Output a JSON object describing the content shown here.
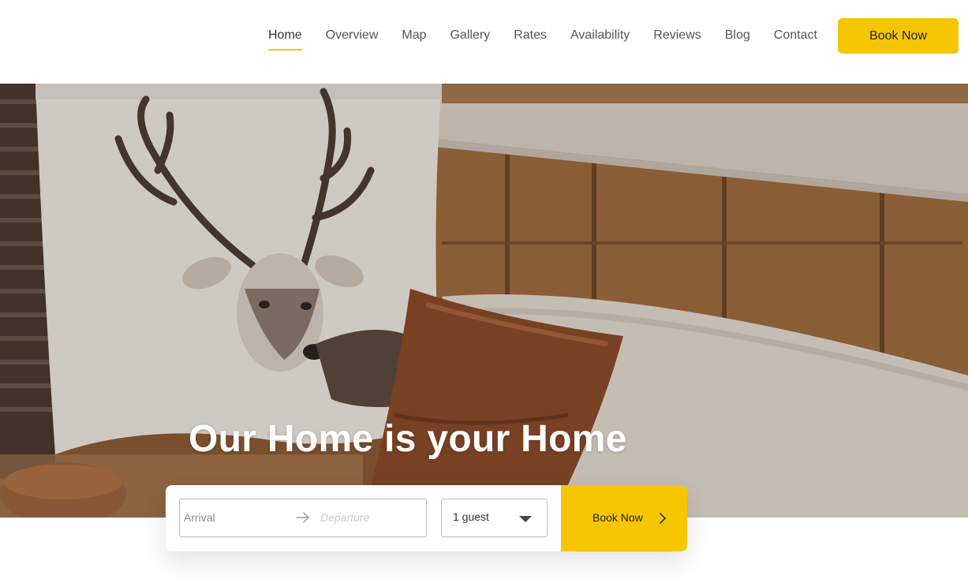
{
  "nav": {
    "items": [
      {
        "label": "Home",
        "active": true
      },
      {
        "label": "Overview"
      },
      {
        "label": "Map"
      },
      {
        "label": "Gallery"
      },
      {
        "label": "Rates"
      },
      {
        "label": "Availability"
      },
      {
        "label": "Reviews"
      },
      {
        "label": "Blog"
      },
      {
        "label": "Contact"
      }
    ],
    "book_label": "Book Now"
  },
  "hero": {
    "title": "Our Home is your Home",
    "image_icon": "living-room-photo"
  },
  "booking": {
    "arrival_placeholder": "Arrival",
    "departure_placeholder": "Departure",
    "guests_value": "1 guest",
    "book_label": "Book Now"
  },
  "colors": {
    "accent": "#f7c600",
    "text": "#333333",
    "nav_text": "#555555"
  }
}
